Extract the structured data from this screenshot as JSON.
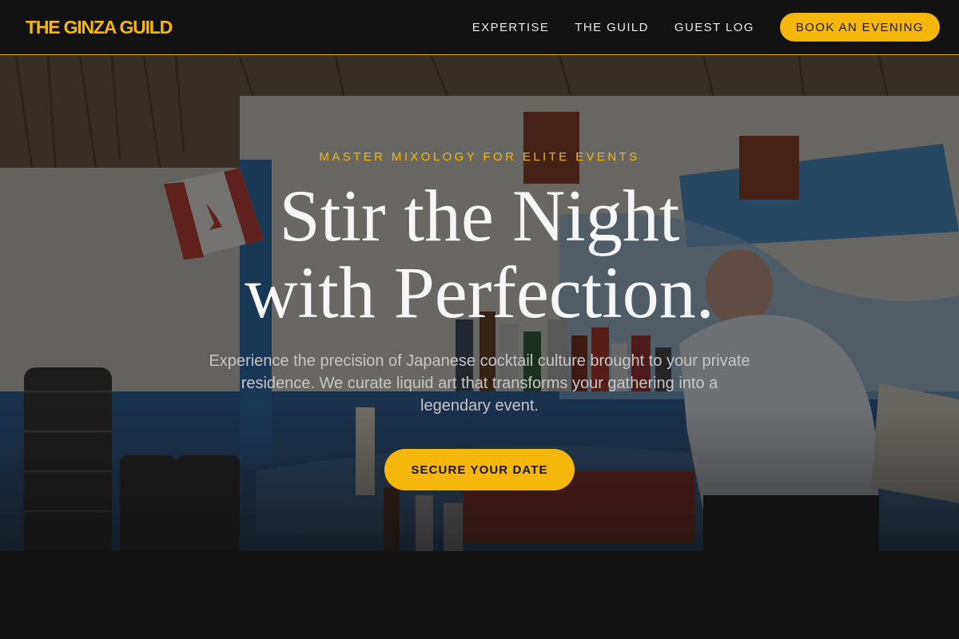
{
  "brand": {
    "name": "THE GINZA GUILD"
  },
  "nav": {
    "links": [
      {
        "label": "EXPERTISE"
      },
      {
        "label": "THE GUILD"
      },
      {
        "label": "GUEST LOG"
      }
    ],
    "book_label": "BOOK AN EVENING"
  },
  "hero": {
    "eyebrow": "MASTER MIXOLOGY FOR ELITE EVENTS",
    "headline_line1": "Stir the Night",
    "headline_line2": "with Perfection.",
    "subtext": "Experience the precision of Japanese cocktail culture brought to your private residence. We curate liquid art that transforms your gathering into a legendary event.",
    "cta_label": "SECURE YOUR DATE",
    "background_image": "bar-interior-photo"
  },
  "colors": {
    "accent": "#f5b70b",
    "header_bg": "#121212",
    "text_light": "#f6f6f6",
    "text_muted": "#c7c7c7"
  }
}
